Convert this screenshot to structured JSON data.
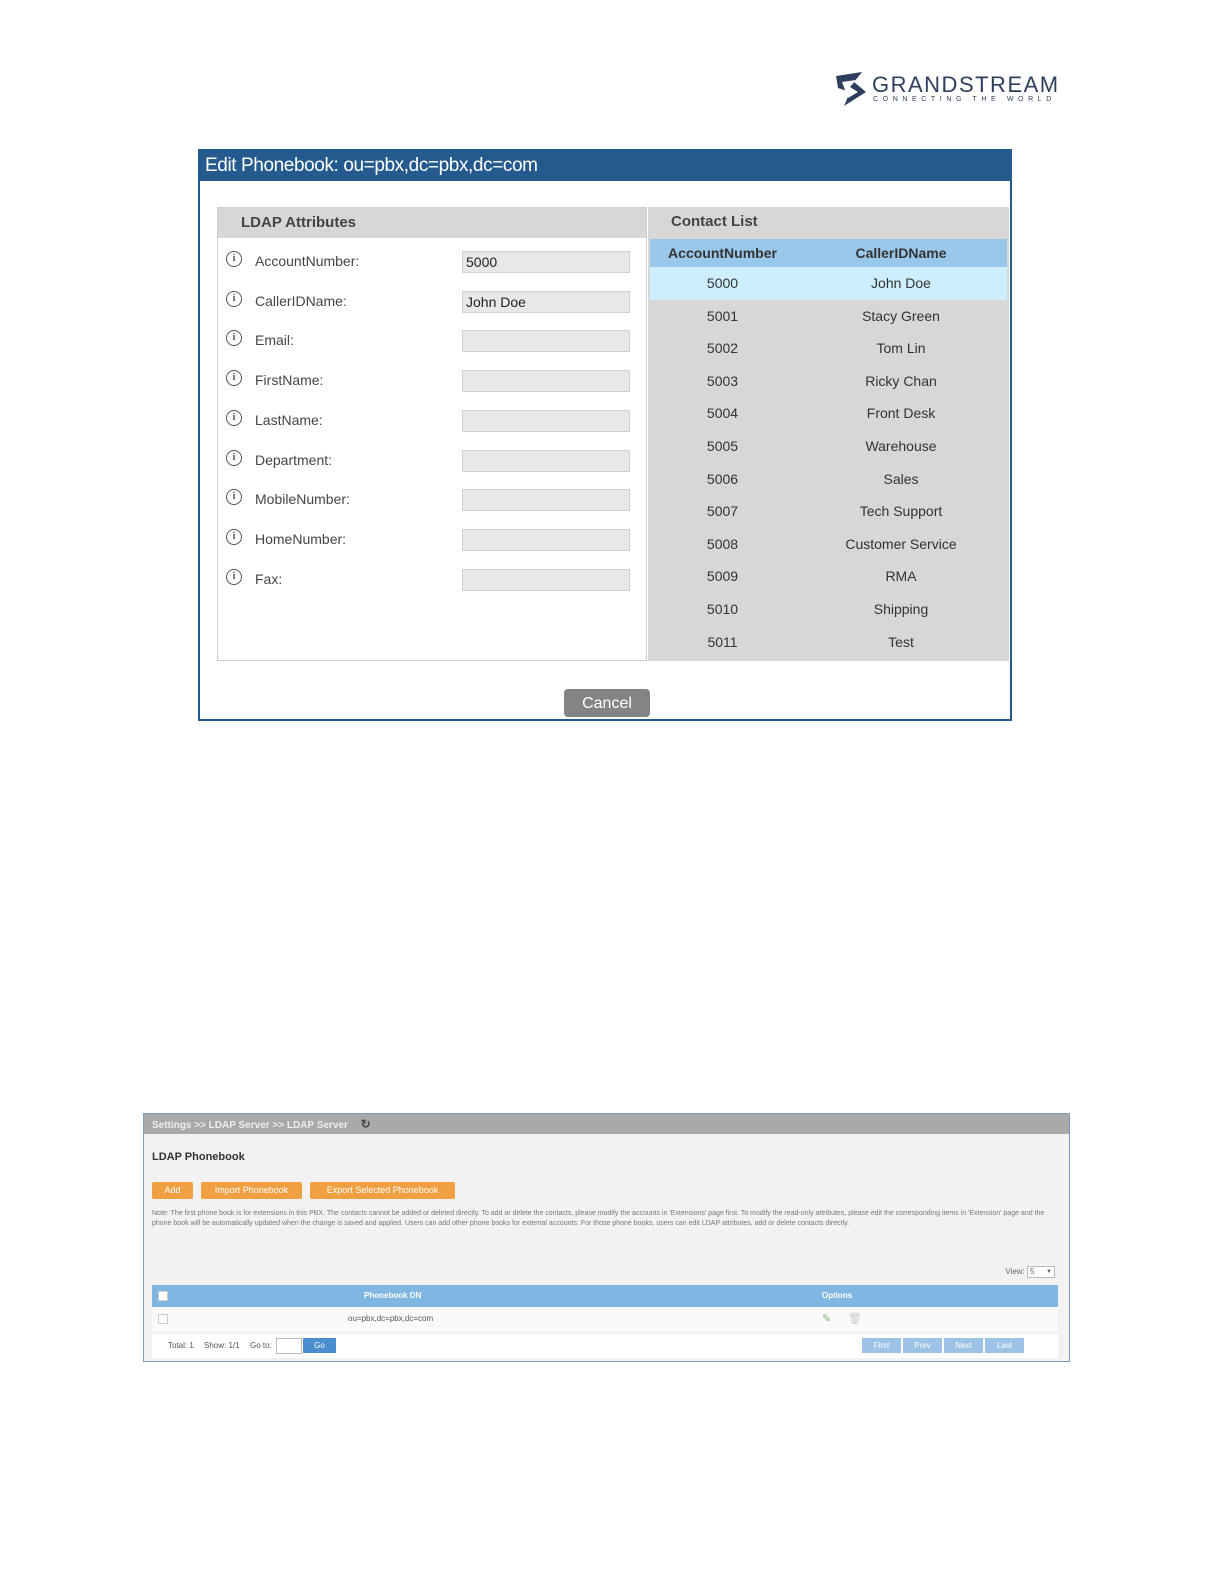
{
  "logo": {
    "brand": "GRANDSTREAM",
    "tagline": "CONNECTING THE WORLD"
  },
  "dialog": {
    "title": "Edit Phonebook: ou=pbx,dc=pbx,dc=com",
    "left_header": "LDAP Attributes",
    "right_header": "Contact List",
    "attributes": [
      {
        "label": "AccountNumber:",
        "value": "5000"
      },
      {
        "label": "CallerIDName:",
        "value": "John Doe"
      },
      {
        "label": "Email:",
        "value": ""
      },
      {
        "label": "FirstName:",
        "value": ""
      },
      {
        "label": "LastName:",
        "value": ""
      },
      {
        "label": "Department:",
        "value": ""
      },
      {
        "label": "MobileNumber:",
        "value": ""
      },
      {
        "label": "HomeNumber:",
        "value": ""
      },
      {
        "label": "Fax:",
        "value": ""
      }
    ],
    "contacts_columns": [
      "AccountNumber",
      "CallerIDName"
    ],
    "contacts": [
      [
        "5000",
        "John Doe"
      ],
      [
        "5001",
        "Stacy Green"
      ],
      [
        "5002",
        "Tom Lin"
      ],
      [
        "5003",
        "Ricky Chan"
      ],
      [
        "5004",
        "Front Desk"
      ],
      [
        "5005",
        "Warehouse"
      ],
      [
        "5006",
        "Sales"
      ],
      [
        "5007",
        "Tech Support"
      ],
      [
        "5008",
        "Customer Service"
      ],
      [
        "5009",
        "RMA"
      ],
      [
        "5010",
        "Shipping"
      ],
      [
        "5011",
        "Test"
      ]
    ],
    "cancel_label": "Cancel"
  },
  "shot2": {
    "breadcrumb": "Settings >> LDAP Server >> LDAP Server",
    "title": "LDAP Phonebook",
    "buttons": [
      "Add",
      "Import Phonebook",
      "Export Selected Phonebook"
    ],
    "note": "Note: The first phone book is for extensions in this PBX. The contacts cannot be added or deleted directly. To add or delete the contacts, please modify the accounts in 'Extensions' page first. To modify the read-only attributes, please edit the corresponding items in 'Extension' page and the phone book will be automatically updated when the change is saved and applied. Users can add other phone books for external accounts. For those phone books, users can edit LDAP attributes, add or delete contacts directly.",
    "view_label": "View:",
    "view_value": "5",
    "col_dn": "Phonebook DN",
    "col_options": "Options",
    "row_dn": "ou=pbx,dc=pbx,dc=com",
    "total": "Total: 1",
    "show": "Show: 1/1",
    "goto": "Go to:",
    "go": "Go",
    "pager": [
      "First",
      "Prev",
      "Next",
      "Last"
    ]
  }
}
